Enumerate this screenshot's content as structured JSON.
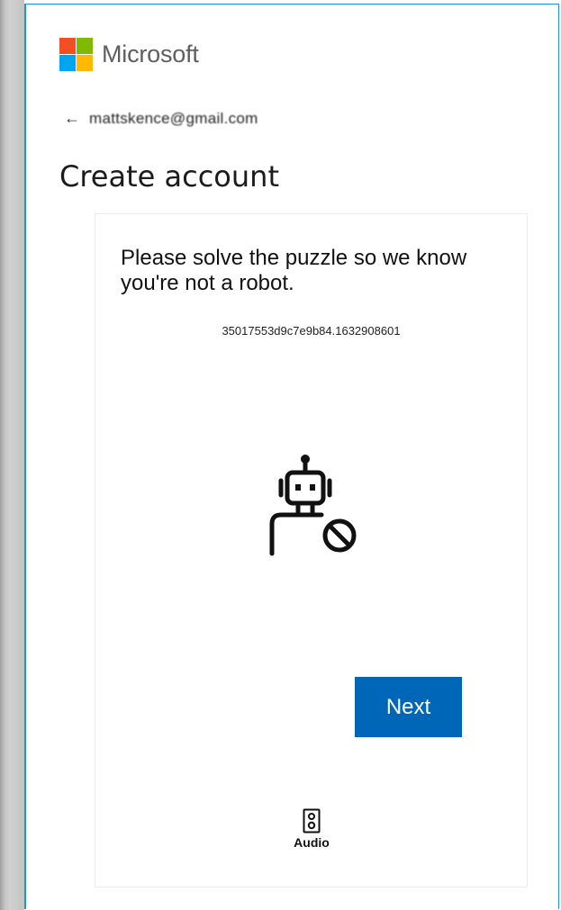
{
  "brand": {
    "name": "Microsoft"
  },
  "back": {
    "arrow": "←",
    "email": "mattskence@gmail.com"
  },
  "page": {
    "title": "Create account"
  },
  "puzzle": {
    "prompt": "Please solve the puzzle so we know you're not a robot.",
    "session_id": "35017553d9c7e9b84.1632908601",
    "illustration": "robot-blocked-icon"
  },
  "actions": {
    "next_label": "Next",
    "audio_label": "Audio",
    "audio_icon": "speaker-icon"
  },
  "colors": {
    "accent_blue": "#0067b8",
    "frame_border": "#1b95e0",
    "logo_red": "#f25022",
    "logo_green": "#7fba00",
    "logo_blue": "#00a4ef",
    "logo_yellow": "#ffb900"
  }
}
